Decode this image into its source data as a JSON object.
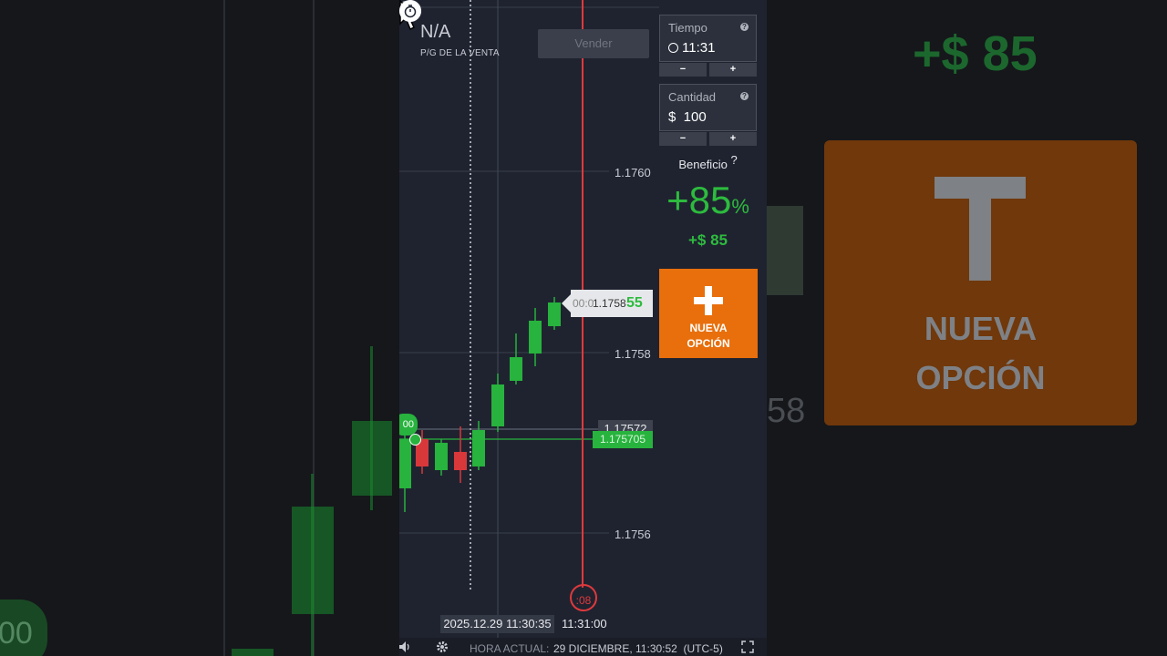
{
  "background": {
    "profit_text": "+$ 85",
    "bubble_text": "00",
    "option_label": "NUEVA\nOPCIÓN",
    "dim_text": "58"
  },
  "chart": {
    "pl_value": "N/A",
    "pl_label": "P/G DE LA VENTA",
    "sell_label": "Vender",
    "prices": [
      "1.1760",
      "1.1758",
      "1.1756"
    ],
    "current_tag": {
      "timer": "00:0",
      "price": "1.1758",
      "payout": "55"
    },
    "alert_price": "1.17572",
    "entry_price": "1.175705",
    "left_bubble": "00",
    "expiry_countdown": ":08",
    "cursor_time": "2025.12.29 11:30:35",
    "expiry_time": "11:31:00"
  },
  "side": {
    "time_label": "Tiempo",
    "time_value": "11:31",
    "amount_label": "Cantidad",
    "amount_value": "$  100",
    "minus": "−",
    "plus": "+",
    "help": "?",
    "benefit_label": "Beneficio",
    "benefit_pct_num": "+85",
    "benefit_pct_sym": "%",
    "benefit_amount": "+$ 85",
    "new_option": "NUEVA\nOPCIÓN"
  },
  "bottom": {
    "clock_label": "HORA ACTUAL:",
    "clock_value": "29 DICIEMBRE, 11:30:52  (UTC-5)"
  },
  "colors": {
    "up": "#27b33d",
    "down": "#d9383b",
    "accent": "#e86f0c",
    "expiry_line": "#e0393c"
  }
}
